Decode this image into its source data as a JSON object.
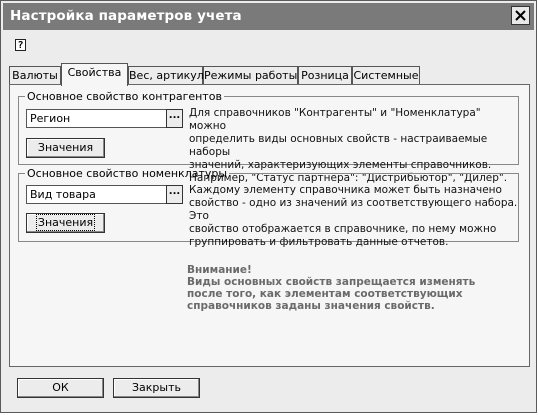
{
  "window": {
    "title": "Настройка параметров учета"
  },
  "toolbar": {
    "help_glyph": "?"
  },
  "tabs": [
    {
      "label": "Валюты"
    },
    {
      "label": "Свойства"
    },
    {
      "label": "Вес, артикул"
    },
    {
      "label": "Режимы работы"
    },
    {
      "label": "Розница"
    },
    {
      "label": "Системные"
    }
  ],
  "group_contragents": {
    "legend": "Основное свойство контрагентов",
    "field_value": "Регион",
    "select_glyph": "...",
    "values_button": "Значения",
    "description": [
      "Для справочников \"Контрагенты\" и \"Номенклатура\" можно",
      "определить виды основных свойств - настраиваемые наборы",
      "значений, характеризующих элементы справочников.",
      "Например, \"Статус партнера\": \"Дистрибьютор\", \"Дилер\"."
    ]
  },
  "group_nomenclature": {
    "legend": "Основное свойство номенклатуры",
    "field_value": "Вид товара",
    "select_glyph": "...",
    "values_button": "Значения",
    "description": [
      "Каждому элементу справочника может быть назначено",
      "свойство - одно из значений из соответствующего набора. Это",
      "свойство отображается в справочнике, по нему можно",
      "группировать и фильтровать данные отчетов."
    ]
  },
  "warning": {
    "lines": [
      "Внимание!",
      "Виды основных свойств запрещается изменять",
      "после того, как элементам соответствующих",
      "справочников заданы значения свойств."
    ]
  },
  "footer": {
    "ok_label": "ОК",
    "close_label": "Закрыть"
  }
}
